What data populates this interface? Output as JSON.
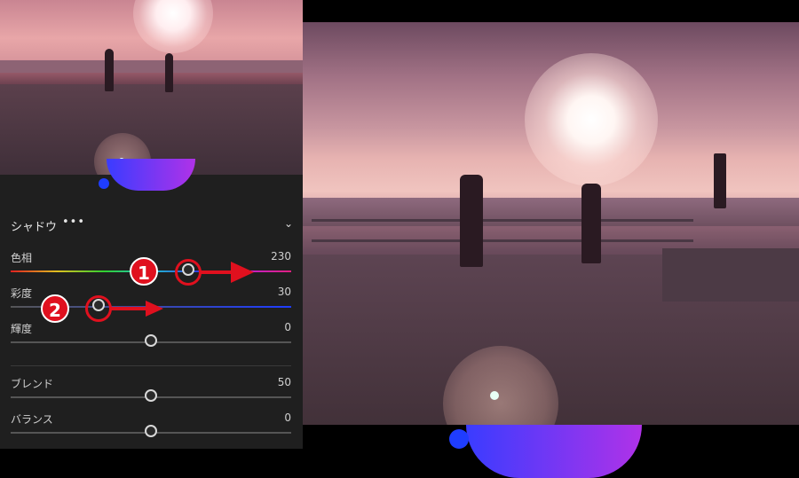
{
  "panel": {
    "section_title": "シャドウ",
    "menu_icon": "more-dots-icon",
    "collapse_icon": "chevron-down-icon",
    "sliders": [
      {
        "label": "色相",
        "value": "230",
        "level": 0.64
      },
      {
        "label": "彩度",
        "value": "30",
        "level": 0.3
      },
      {
        "label": "輝度",
        "value": "0",
        "level": 0.5
      },
      {
        "label": "ブレンド",
        "value": "50",
        "level": 0.5
      },
      {
        "label": "バランス",
        "value": "0",
        "level": 0.5
      }
    ]
  },
  "annotations": {
    "callout_1": "1",
    "callout_2": "2",
    "color": "#e0101e"
  },
  "colors": {
    "wheel_start": "#3a3cff",
    "wheel_end": "#b032e8",
    "hue_track": "rainbow",
    "sat_track": "#1f3dff"
  }
}
